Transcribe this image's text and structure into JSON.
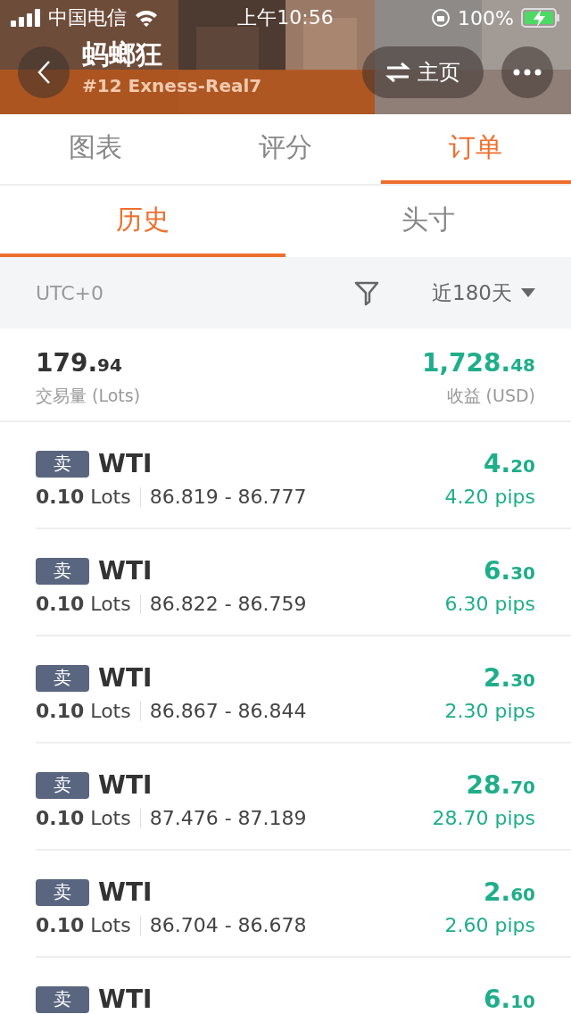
{
  "status_bar": {
    "carrier": "中国电信",
    "time": "上午10:56",
    "battery": "100%"
  },
  "header": {
    "kind": "picture",
    "title": "蚂螂狂",
    "subtitle": "#12 Exness-Real7",
    "home_button": "主页"
  },
  "tabs": [
    {
      "label": "图表",
      "selected": false
    },
    {
      "label": "评分",
      "selected": false
    },
    {
      "label": "订单",
      "selected": true
    }
  ],
  "sub_tabs": [
    {
      "label": "历史",
      "selected": true
    },
    {
      "label": "头寸",
      "selected": false
    }
  ],
  "filter_bar": {
    "timezone": "UTC+0",
    "period": "近180天"
  },
  "summary": {
    "volume": {
      "whole": "179.",
      "fraction": "94",
      "label": "交易量 (Lots)"
    },
    "profit": {
      "whole": "1,728.",
      "fraction": "48",
      "label": "收益 (USD)"
    }
  },
  "orders": [
    {
      "side": "卖",
      "symbol": "WTI",
      "lots": "0.10",
      "lots_unit": "Lots",
      "prices": "86.819 - 86.777",
      "profit_whole": "4.",
      "profit_fraction": "20",
      "pips": "4.20 pips"
    },
    {
      "side": "卖",
      "symbol": "WTI",
      "lots": "0.10",
      "lots_unit": "Lots",
      "prices": "86.822 - 86.759",
      "profit_whole": "6.",
      "profit_fraction": "30",
      "pips": "6.30 pips"
    },
    {
      "side": "卖",
      "symbol": "WTI",
      "lots": "0.10",
      "lots_unit": "Lots",
      "prices": "86.867 - 86.844",
      "profit_whole": "2.",
      "profit_fraction": "30",
      "pips": "2.30 pips"
    },
    {
      "side": "卖",
      "symbol": "WTI",
      "lots": "0.10",
      "lots_unit": "Lots",
      "prices": "87.476 - 87.189",
      "profit_whole": "28.",
      "profit_fraction": "70",
      "pips": "28.70 pips"
    },
    {
      "side": "卖",
      "symbol": "WTI",
      "lots": "0.10",
      "lots_unit": "Lots",
      "prices": "86.704 - 86.678",
      "profit_whole": "2.",
      "profit_fraction": "60",
      "pips": "2.60 pips"
    },
    {
      "side": "卖",
      "symbol": "WTI",
      "profit_whole": "6.",
      "profit_fraction": "10"
    }
  ]
}
